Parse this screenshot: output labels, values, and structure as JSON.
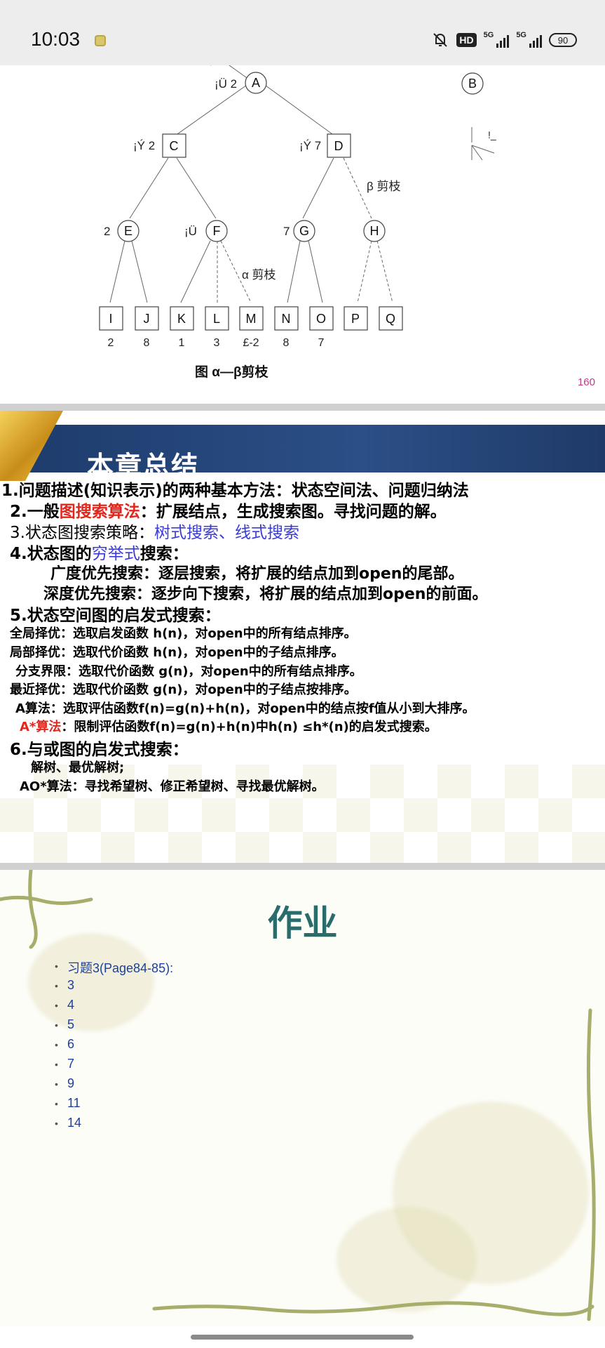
{
  "status_bar": {
    "time": "10:03",
    "hd_label": "HD",
    "signal1_label": "5G",
    "signal2_label": "5G",
    "battery": "90"
  },
  "slide1": {
    "caption": "图    α—β剪枝",
    "page_number": "160",
    "labels": {
      "a_value": "¡Ü 2",
      "c_value": "¡Ý 2",
      "d_value": "¡Ý 7",
      "e_value": "2",
      "f_value": "¡Ü",
      "g_value": "7",
      "beta_cut": "β 剪枝",
      "alpha_cut": "α 剪枝",
      "b_mark": "!_"
    },
    "nodes": [
      "A",
      "B",
      "C",
      "D",
      "E",
      "F",
      "G",
      "H"
    ],
    "leaves": [
      "I",
      "J",
      "K",
      "L",
      "M",
      "N",
      "O",
      "P",
      "Q"
    ],
    "leaf_values": [
      "2",
      "8",
      "1",
      "3",
      "£-2",
      "8",
      "7"
    ]
  },
  "slide2": {
    "title": "本章总结",
    "l1": "1.问题描述(知识表示)的两种基本方法：状态空间法、问题归纳法",
    "l2_a": "2.一般",
    "l2_red": "图搜索算法",
    "l2_b": "：扩展结点，生成搜索图。寻找问题的解。",
    "l3_a": "3.状态图搜索策略：",
    "l3_blue": "树式搜索、线式搜索",
    "l4_a": "4.状态图的",
    "l4_blue": "穷举式",
    "l4_b": "搜索：",
    "l4_1": "广度优先搜索：逐层搜索，将扩展的结点加到open的尾部。",
    "l4_2": "深度优先搜索：逐步向下搜索，将扩展的结点加到open的前面。",
    "l5": "5.状态空间图的启发式搜索：",
    "l5_1": "全局择优：选取启发函数 h(n)，对open中的所有结点排序。",
    "l5_2": "局部择优：选取代价函数 h(n)，对open中的子结点排序。",
    "l5_3": "分支界限：选取代价函数 g(n)，对open中的所有结点排序。",
    "l5_4": "最近择优：选取代价函数 g(n)，对open中的子结点按排序。",
    "l5_5": "A算法：选取评估函数f(n)=g(n)+h(n)，对open中的结点按f值从小到大排序。",
    "l5_6_red": "A*算法",
    "l5_6_b": "：限制评估函数f(n)=g(n)+h(n)中h(n) ≤h*(n)的启发式搜索。",
    "l6": "6.与或图的启发式搜索：",
    "l6_1": "解树、最优解树;",
    "l6_2": "AO*算法：寻找希望树、修正希望树、寻找最优解树。"
  },
  "slide3": {
    "title": "作业",
    "items": [
      "习题3(Page84-85):",
      "3",
      "4",
      "5",
      "6",
      "7",
      "9",
      "11",
      "14"
    ]
  }
}
